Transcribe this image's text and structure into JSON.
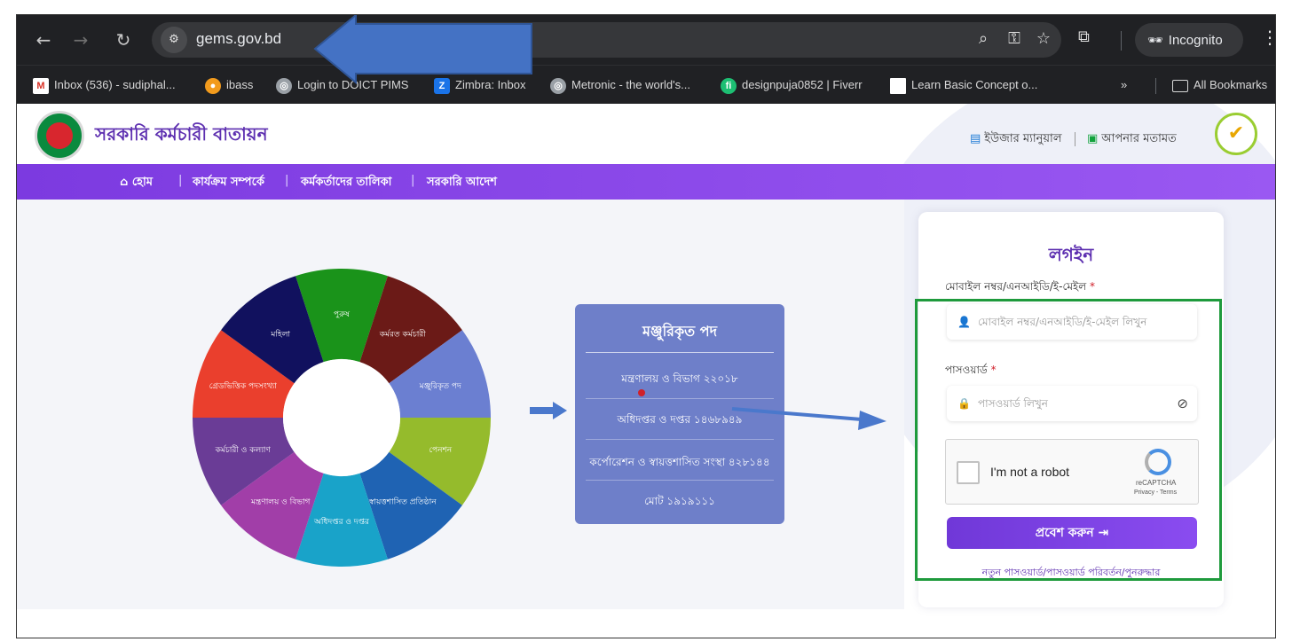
{
  "browser": {
    "url": "gems.gov.bd",
    "incognito_label": "Incognito",
    "bookmarks": [
      {
        "label": "Inbox (536) - sudiphal...",
        "icon": "gmail-icon"
      },
      {
        "label": "ibass",
        "icon": "ibass-icon"
      },
      {
        "label": "Login to DOICT PIMS",
        "icon": "globe-icon"
      },
      {
        "label": "Zimbra: Inbox",
        "icon": "zimbra-icon"
      },
      {
        "label": "Metronic - the world's...",
        "icon": "globe-icon"
      },
      {
        "label": "designpuja0852 | Fiverr",
        "icon": "fiverr-icon"
      },
      {
        "label": "Learn Basic Concept o...",
        "icon": "page-icon"
      }
    ],
    "more_bookmarks": "»",
    "all_bookmarks_label": "All Bookmarks"
  },
  "site": {
    "title": "সরকারি কর্মচারী বাতায়ন",
    "user_manual": "ইউজার ম্যানুয়াল",
    "feedback": "আপনার মতামত",
    "menu": [
      "হোম",
      "কার্যক্রম সম্পর্কে",
      "কর্মকর্তাদের তালিকা",
      "সরকারি আদেশ"
    ],
    "menu_separator": "|"
  },
  "donut": {
    "segments": [
      {
        "label": "পুরুষ",
        "color": "#1a931a"
      },
      {
        "label": "কর্মরত কর্মচারী",
        "color": "#6b1a17"
      },
      {
        "label": "মঞ্জুরিকৃত পদ",
        "color": "#6b7fd1"
      },
      {
        "label": "পেনশন",
        "color": "#95bb2c"
      },
      {
        "label": "স্বায়ত্তশাসিত প্রতিষ্ঠান",
        "color": "#1f63b3"
      },
      {
        "label": "অধিদপ্তর ও দপ্তর",
        "color": "#19a3c9"
      },
      {
        "label": "মন্ত্রণালয় ও বিভাগ",
        "color": "#a13ea8"
      },
      {
        "label": "কর্মচারী ও কল্যাণ",
        "color": "#6a3c96"
      },
      {
        "label": "গ্রেডভিত্তিক পদসংখ্যা",
        "color": "#ea3f2d"
      },
      {
        "label": "মহিলা",
        "color": "#11115e"
      }
    ]
  },
  "posts": {
    "title": "মঞ্জুরিকৃত পদ",
    "rows": [
      "মন্ত্রণালয় ও বিভাগ ২২০১৮",
      "অধিদপ্তর ও দপ্তর ১৪৬৮৯৪৯",
      "কর্পোরেশন ও স্বায়ত্তশাসিত সংস্থা ৪২৮১৪৪",
      "মোট ১৯১৯১১১"
    ]
  },
  "login": {
    "title": "লগইন",
    "user_label": "মোবাইল নম্বর/এনআইডি/ই-মেইল",
    "user_placeholder": "মোবাইল নম্বর/এনআইডি/ই-মেইল লিখুন",
    "password_label": "পাসওয়ার্ড",
    "password_placeholder": "পাসওয়ার্ড লিখুন",
    "required_mark": "*",
    "captcha_text": "I'm not a robot",
    "captcha_brand": "reCAPTCHA",
    "captcha_terms": "Privacy - Terms",
    "submit": "প্রবেশ করুন",
    "reset_link": "নতুন পাসওয়ার্ড/পাসওয়ার্ড পরিবর্তন/পুনরুদ্ধার"
  },
  "colors": {
    "brand_purple": "#7c3ae0",
    "annotation_arrow": "#3f6fc8",
    "highlight_box": "#1e9a3c"
  }
}
